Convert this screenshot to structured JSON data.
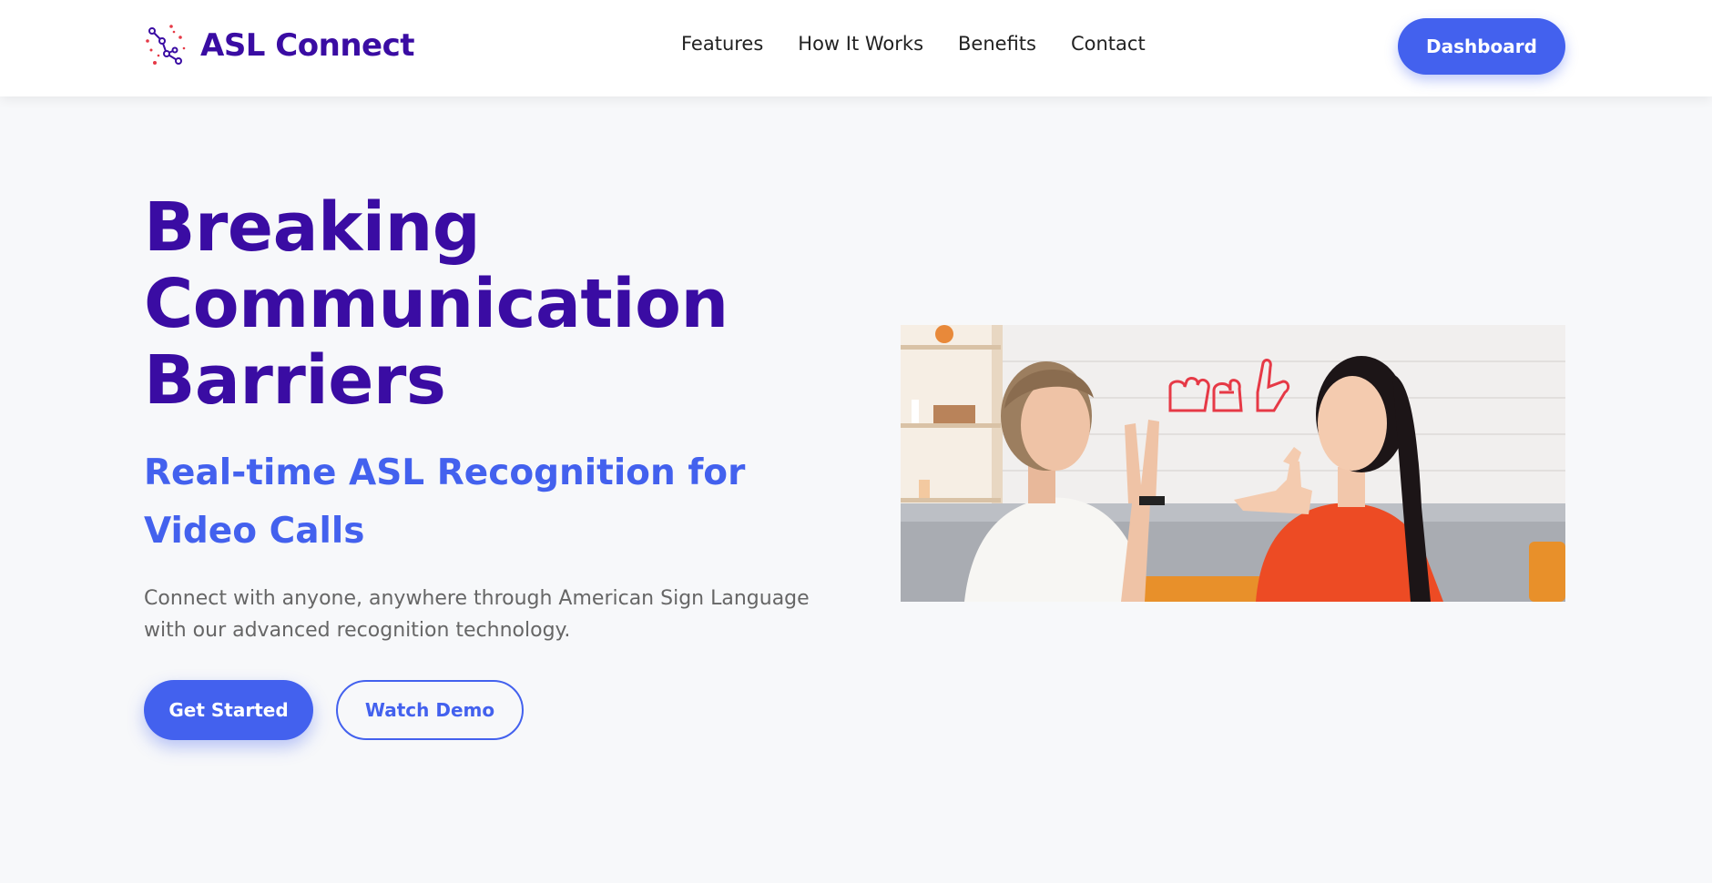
{
  "brand": {
    "name": "ASL Connect",
    "logo_icon": "constellation-icon",
    "colors": {
      "primary": "#4361ee",
      "dark": "#3a0ca3",
      "accent": "#e63946"
    }
  },
  "nav": {
    "links": [
      "Features",
      "How It Works",
      "Benefits",
      "Contact"
    ],
    "cta_label": "Dashboard"
  },
  "hero": {
    "title": "Breaking Communication Barriers",
    "subtitle": "Real-time ASL Recognition for Video Calls",
    "description": "Connect with anyone, anywhere through American Sign Language with our advanced recognition technology.",
    "primary_button": "Get Started",
    "secondary_button": "Watch Demo"
  }
}
